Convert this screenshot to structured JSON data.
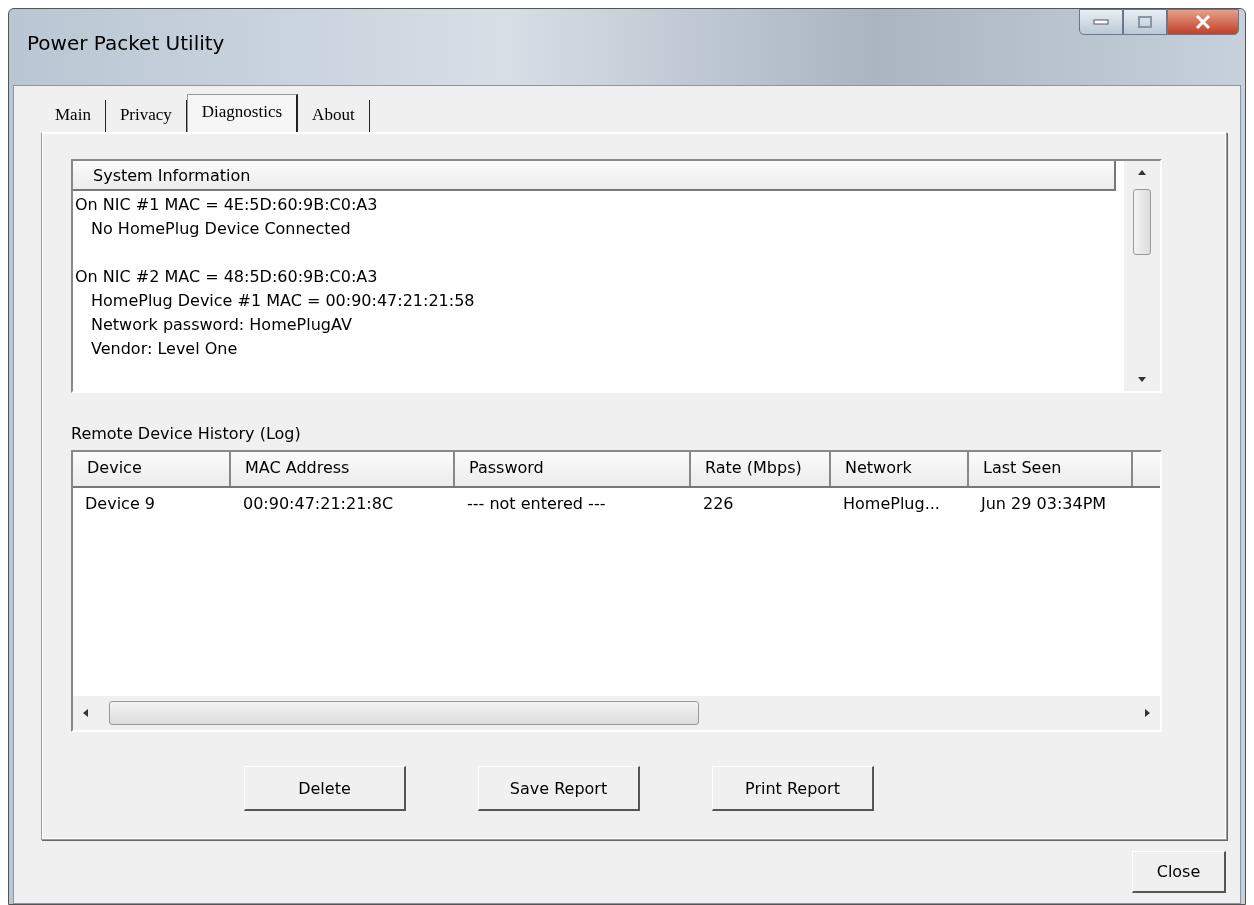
{
  "window": {
    "title": "Power Packet Utility"
  },
  "tabs": [
    {
      "label": "Main",
      "selected": false
    },
    {
      "label": "Privacy",
      "selected": false
    },
    {
      "label": "Diagnostics",
      "selected": true
    },
    {
      "label": "About",
      "selected": false
    }
  ],
  "system_info": {
    "header": "System Information",
    "entries": [
      {
        "text": "On NIC #1 MAC = 4E:5D:60:9B:C0:A3",
        "children": [
          {
            "text": "No HomePlug Device Connected"
          }
        ]
      },
      {
        "text": "On NIC #2 MAC = 48:5D:60:9B:C0:A3",
        "children": [
          {
            "text": "HomePlug Device #1 MAC = 00:90:47:21:21:58"
          },
          {
            "text": "Network password: HomePlugAV"
          },
          {
            "text": "Vendor: Level One"
          }
        ]
      }
    ]
  },
  "log": {
    "label": "Remote Device History (Log)",
    "columns": [
      "Device",
      "MAC Address",
      "Password",
      "Rate (Mbps)",
      "Network",
      "Last Seen"
    ],
    "rows": [
      [
        "Device 9",
        "00:90:47:21:21:8C",
        "--- not entered ---",
        "226",
        "HomePlug...",
        "Jun 29 03:34PM"
      ]
    ]
  },
  "buttons": [
    "Delete",
    "Save Report",
    "Print Report"
  ],
  "close_button": "Close"
}
